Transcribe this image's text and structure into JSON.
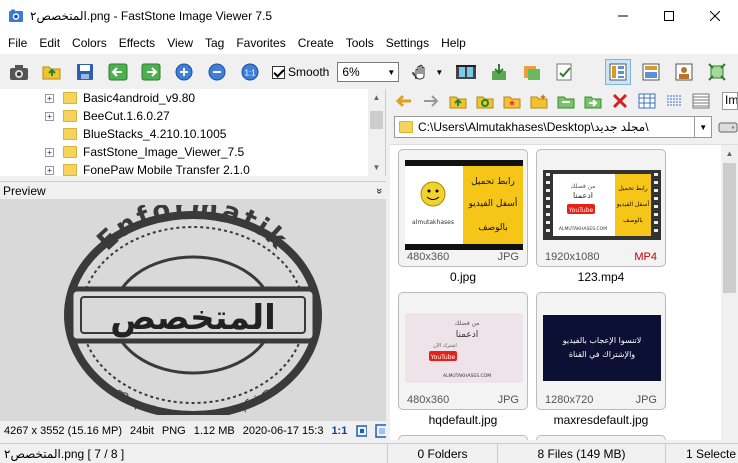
{
  "window": {
    "title": "المتخصص٢.png - FastStone Image Viewer 7.5",
    "minimize_label": "—",
    "maximize_label": "☐",
    "close_label": "✕"
  },
  "menu": [
    "File",
    "Edit",
    "Colors",
    "Effects",
    "View",
    "Tag",
    "Favorites",
    "Create",
    "Tools",
    "Settings",
    "Help"
  ],
  "toolbar": {
    "smooth_label": "Smooth",
    "smooth_checked": true,
    "zoom_value": "6%",
    "icons": [
      "camera-icon",
      "open-folder-icon",
      "save-icon",
      "previous-icon",
      "next-icon",
      "zoom-in-icon",
      "zoom-out-icon",
      "actual-size-icon"
    ],
    "right_icons": [
      "pan-hand-icon",
      "slideshow-icon",
      "move-to-icon",
      "copy-to-icon",
      "select-icon",
      "layout-thumbnails-icon",
      "layout-preview-icon",
      "layout-fullscreen-icon",
      "fit-window-icon"
    ]
  },
  "tree": {
    "items": [
      {
        "label": "Basic4android_v9.80",
        "expandable": true
      },
      {
        "label": "BeeCut.1.6.0.27",
        "expandable": true
      },
      {
        "label": "BlueStacks_4.210.10.1005",
        "expandable": false
      },
      {
        "label": "FastStone_Image_Viewer_7.5",
        "expandable": true
      },
      {
        "label": "FonePaw Mobile Transfer 2.1.0",
        "expandable": true
      }
    ]
  },
  "preview": {
    "header": "Preview",
    "collapse_label": "»",
    "logo_text_top": "Enformatik",
    "logo_text_main": "المتخصص",
    "logo_text_bottom": "كل ما هو جديد في عالم المعلوميات"
  },
  "image_info": {
    "dimensions": "4267 x 3552 (15.16 MP)",
    "depth": "24bit",
    "format": "PNG",
    "size": "1.12 MB",
    "date": "2020-06-17 15:3",
    "ratio": "1:1"
  },
  "path": {
    "value": "C:\\Users\\Almutakhases\\Desktop\\مجلد جديد\\"
  },
  "thumbnails": [
    {
      "name": "0.jpg",
      "dims": "480x360",
      "ext": "JPG",
      "video": false,
      "top_text": "رابط تحميل",
      "mid_text": "أسفل الفيديو",
      "bottom_text": "بالوصف",
      "caption": "almutakhases"
    },
    {
      "name": "123.mp4",
      "dims": "1920x1080",
      "ext": "MP4",
      "video": true,
      "top_text": "رابط تحميل",
      "mid_text": "أسفل الفيديو",
      "bottom_text": "بالوصف",
      "caption": "ALMUTAKHASES.COM"
    },
    {
      "name": "hqdefault.jpg",
      "dims": "480x360",
      "ext": "JPG",
      "video": false,
      "top_text": "من فضلك",
      "mid_text": "ادعمنا",
      "bottom_text": "اشترك الآن",
      "caption": "ALMUTAKHASES.COM"
    },
    {
      "name": "maxresdefault.jpg",
      "dims": "1280x720",
      "ext": "JPG",
      "video": false,
      "top_text": "لاتنسوا الإعجاب بالفيديو",
      "mid_text": "والإشتراك في القناة",
      "bottom_text": "",
      "caption": ""
    }
  ],
  "status": {
    "file": "المتخصص٢.png [ 7 / 8 ]",
    "folders": "0 Folders",
    "files": "8 Files (149 MB)",
    "selected": "1 Selecte"
  },
  "colors": {
    "yellow": "#f5c518",
    "youtube_red": "#e62117",
    "dark_navy": "#0c1035",
    "stamp": "#3a3a3a"
  }
}
